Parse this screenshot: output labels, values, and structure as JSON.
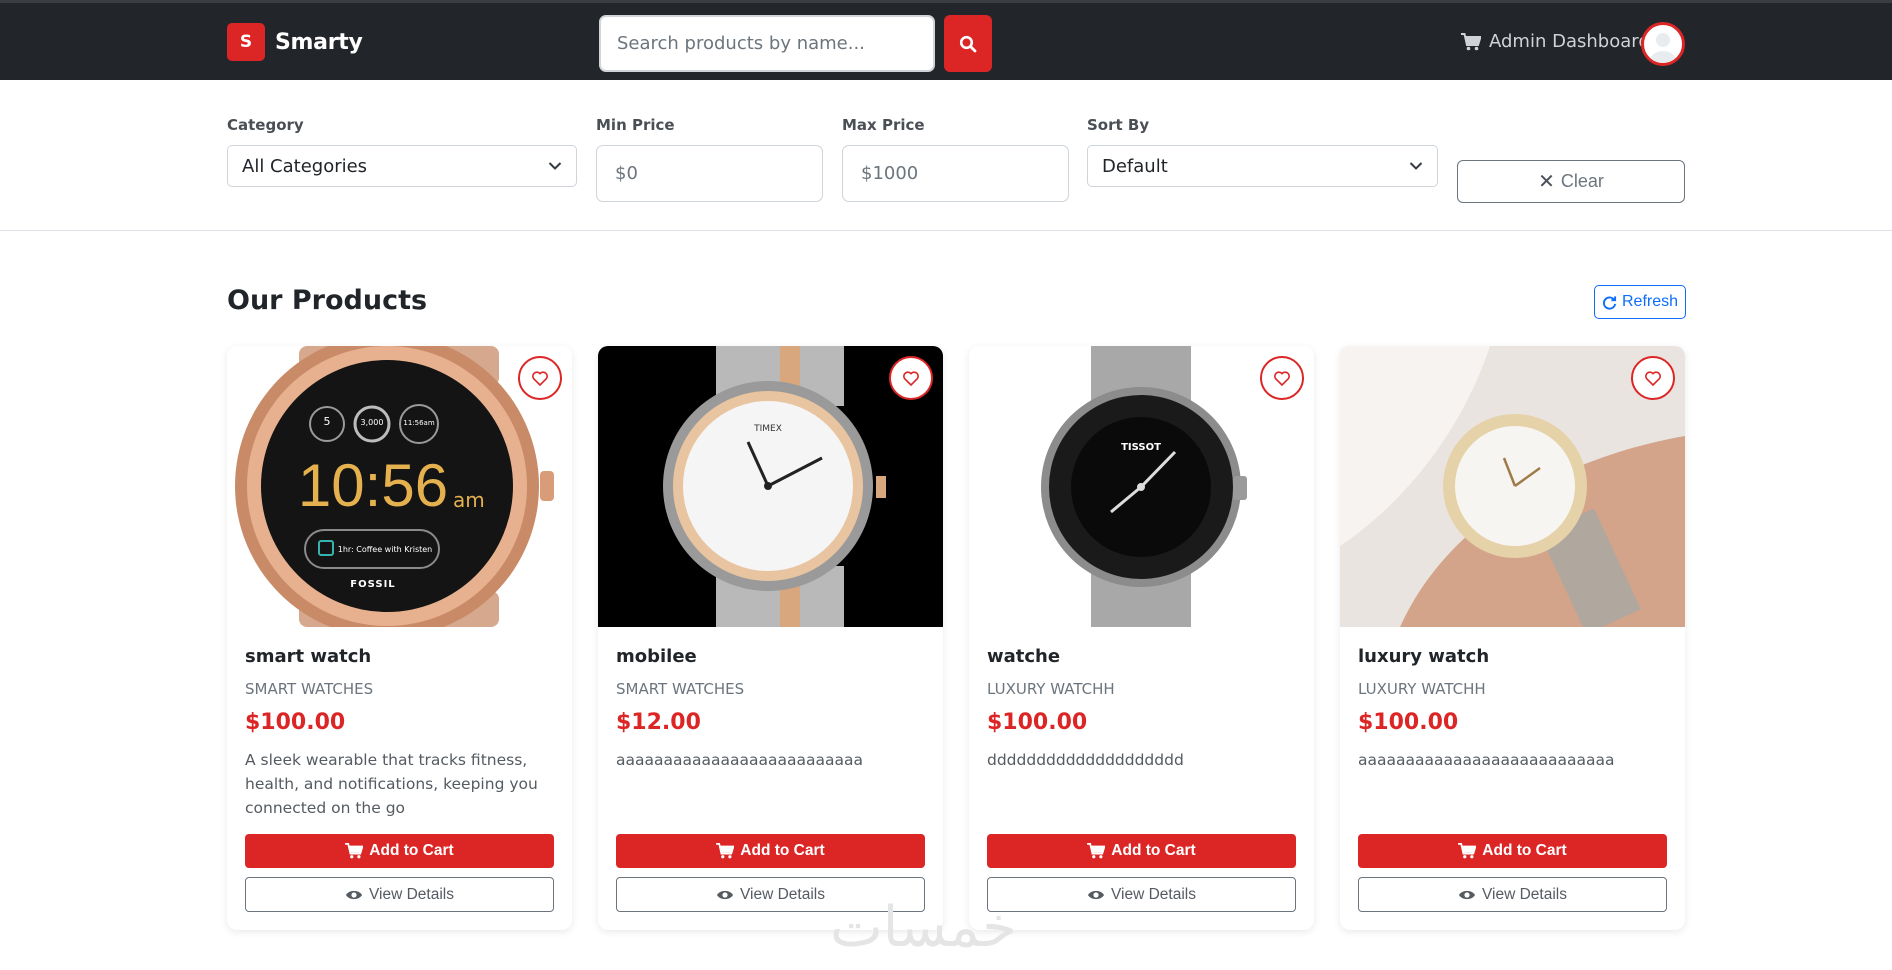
{
  "nav": {
    "brand_letter": "S",
    "brand_name": "Smarty",
    "search_placeholder": "Search products by name...",
    "admin_label": "Admin Dashboard",
    "accent": "#dc2626"
  },
  "filters": {
    "category_label": "Category",
    "category_value": "All Categories",
    "min_label": "Min Price",
    "min_placeholder": "$0",
    "max_label": "Max Price",
    "max_placeholder": "$1000",
    "sort_label": "Sort By",
    "sort_value": "Default",
    "clear_label": "Clear"
  },
  "products": {
    "title": "Our Products",
    "refresh_label": "Refresh",
    "add_label": "Add to Cart",
    "view_label": "View Details",
    "items": [
      {
        "name": "smart watch",
        "category": "SMART WATCHES",
        "price": "$100.00",
        "description": "A sleek wearable that tracks fitness, health, and notifications, keeping you connected on the go",
        "watch_time": "10:56",
        "watch_ampm": "am",
        "watch_brand": "FOSSIL",
        "watch_event": "1hr: Coffee with Kristen",
        "watch_stat1": "5",
        "watch_stat2": "3,000",
        "watch_stat3": "11:56am"
      },
      {
        "name": "mobilee",
        "category": "SMART WATCHES",
        "price": "$12.00",
        "description": "aaaaaaaaaaaaaaaaaaaaaaaaaa",
        "watch_brand": "TIMEX"
      },
      {
        "name": "watche",
        "category": "LUXURY WATCHH",
        "price": "$100.00",
        "description": "dddddddddddddddddddd",
        "watch_brand": "TISSOT"
      },
      {
        "name": "luxury watch",
        "category": "LUXURY WATCHH",
        "price": "$100.00",
        "description": "aaaaaaaaaaaaaaaaaaaaaaaaaaa"
      }
    ]
  },
  "watermark": "خمسات"
}
